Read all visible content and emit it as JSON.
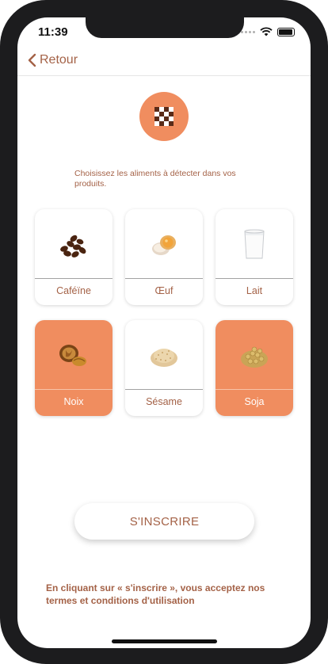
{
  "status_bar": {
    "time": "11:39"
  },
  "nav": {
    "back_label": "Retour"
  },
  "intro": "Choisissez les aliments à détecter dans vos produits.",
  "foods": [
    {
      "label": "Caféïne",
      "selected": false,
      "icon": "coffee-beans-icon"
    },
    {
      "label": "Œuf",
      "selected": false,
      "icon": "egg-icon"
    },
    {
      "label": "Lait",
      "selected": false,
      "icon": "milk-glass-icon"
    },
    {
      "label": "Noix",
      "selected": true,
      "icon": "walnut-icon"
    },
    {
      "label": "Sésame",
      "selected": false,
      "icon": "sesame-icon"
    },
    {
      "label": "Soja",
      "selected": true,
      "icon": "soy-icon"
    }
  ],
  "signup_label": "S'INSCRIRE",
  "terms": "En cliquant sur « s'inscrire », vous acceptez nos termes et conditions d'utilisation",
  "colors": {
    "accent": "#f08d5f",
    "text_brown": "#a46247"
  }
}
